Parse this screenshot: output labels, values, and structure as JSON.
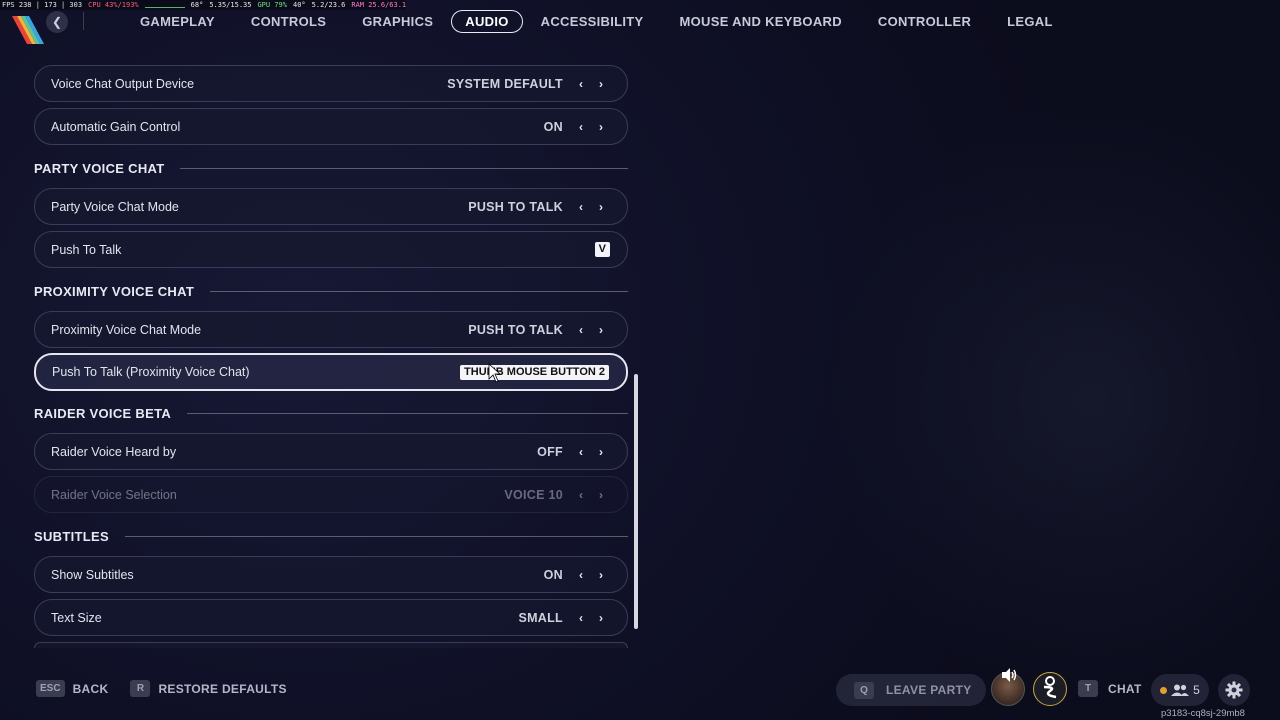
{
  "perf": {
    "fps": "FPS 238 | 173 | 303",
    "cpu": "CPU 43%/193%",
    "cpu_temp": "68°",
    "cpu_freq": "5.35/15.35",
    "gpu": "GPU 79%",
    "gpu_temp": "40°",
    "gpu_mem": "5.2/23.6",
    "ram": "RAM 25.6/63.1"
  },
  "nav": {
    "back_icon": "chevron-left-icon",
    "tabs": [
      {
        "label": "GAMEPLAY",
        "active": false
      },
      {
        "label": "CONTROLS",
        "active": false
      },
      {
        "label": "GRAPHICS",
        "active": false
      },
      {
        "label": "AUDIO",
        "active": true
      },
      {
        "label": "ACCESSIBILITY",
        "active": false
      },
      {
        "label": "MOUSE AND KEYBOARD",
        "active": false
      },
      {
        "label": "CONTROLLER",
        "active": false
      },
      {
        "label": "LEGAL",
        "active": false
      }
    ]
  },
  "settings": {
    "voice_output": {
      "label": "Voice Chat Output Device",
      "value": "SYSTEM DEFAULT"
    },
    "agc": {
      "label": "Automatic Gain Control",
      "value": "ON"
    },
    "party_section": "PARTY VOICE CHAT",
    "party_mode": {
      "label": "Party Voice Chat Mode",
      "value": "PUSH TO TALK"
    },
    "party_ptt": {
      "label": "Push To Talk",
      "key": "V"
    },
    "proximity_section": "PROXIMITY VOICE CHAT",
    "proximity_mode": {
      "label": "Proximity Voice Chat Mode",
      "value": "PUSH TO TALK"
    },
    "proximity_ptt": {
      "label": "Push To Talk (Proximity Voice Chat)",
      "key": "THUMB MOUSE BUTTON 2"
    },
    "raider_section": "RAIDER VOICE BETA",
    "raider_heard": {
      "label": "Raider Voice Heard by",
      "value": "OFF"
    },
    "raider_selection": {
      "label": "Raider Voice Selection",
      "value": "VOICE 10"
    },
    "subtitles_section": "SUBTITLES",
    "show_subtitles": {
      "label": "Show Subtitles",
      "value": "ON"
    },
    "text_size": {
      "label": "Text Size",
      "value": "SMALL"
    }
  },
  "bottom": {
    "back_key": "ESC",
    "back_label": "BACK",
    "restore_key": "R",
    "restore_label": "RESTORE DEFAULTS",
    "leave_key": "Q",
    "leave_label": "LEAVE PARTY",
    "chat_key": "T",
    "chat_label": "CHAT",
    "friends_count": "5",
    "session_id": "p3183-cq8sj-29mb8"
  },
  "colors": {
    "background": "#0f1026",
    "row_border": "#3a3c58",
    "focused_border": "#e6e6f0",
    "status_dot": "#e0a030"
  }
}
